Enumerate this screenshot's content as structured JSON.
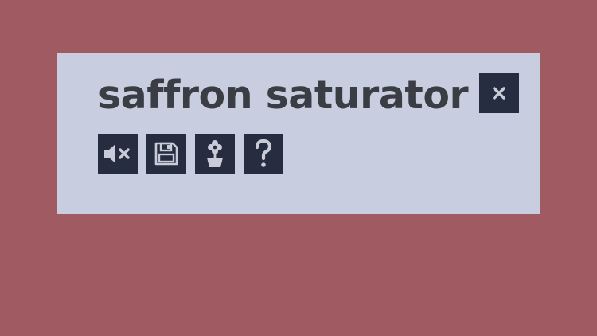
{
  "colors": {
    "background": "#a05a61",
    "panel": "#c8cedf",
    "title_text": "#3b3d44",
    "button_bg": "#262d40",
    "icon": "#c9ccd8"
  },
  "title": "saffron saturator",
  "buttons": [
    {
      "name": "close-button",
      "icon": "close-icon"
    },
    {
      "name": "mute-button",
      "icon": "speaker-muted-icon"
    },
    {
      "name": "save-button",
      "icon": "floppy-disk-icon"
    },
    {
      "name": "plant-button",
      "icon": "potted-flower-icon"
    },
    {
      "name": "help-button",
      "icon": "question-mark-icon"
    }
  ]
}
